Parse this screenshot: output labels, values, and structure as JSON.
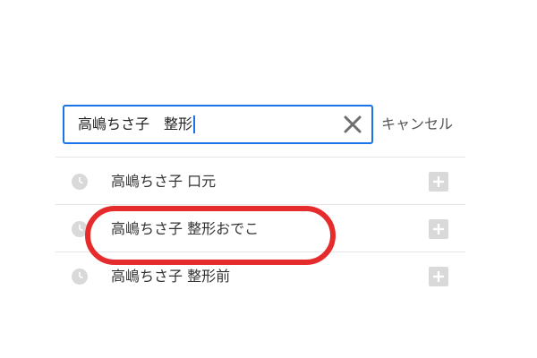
{
  "search": {
    "value": "高嶋ちさ子　整形"
  },
  "cancel_label": "キャンセル",
  "suggestions": [
    {
      "label": "高嶋ちさ子 口元"
    },
    {
      "label": "高嶋ちさ子 整形おでこ"
    },
    {
      "label": "高嶋ちさ子 整形前"
    }
  ],
  "icons": {
    "clear": "close-icon",
    "history": "clock-icon",
    "append": "plus-icon"
  },
  "colors": {
    "focus_border": "#1a73e8",
    "highlight": "#e52b2b",
    "icon_gray": "#d9d9d9"
  }
}
